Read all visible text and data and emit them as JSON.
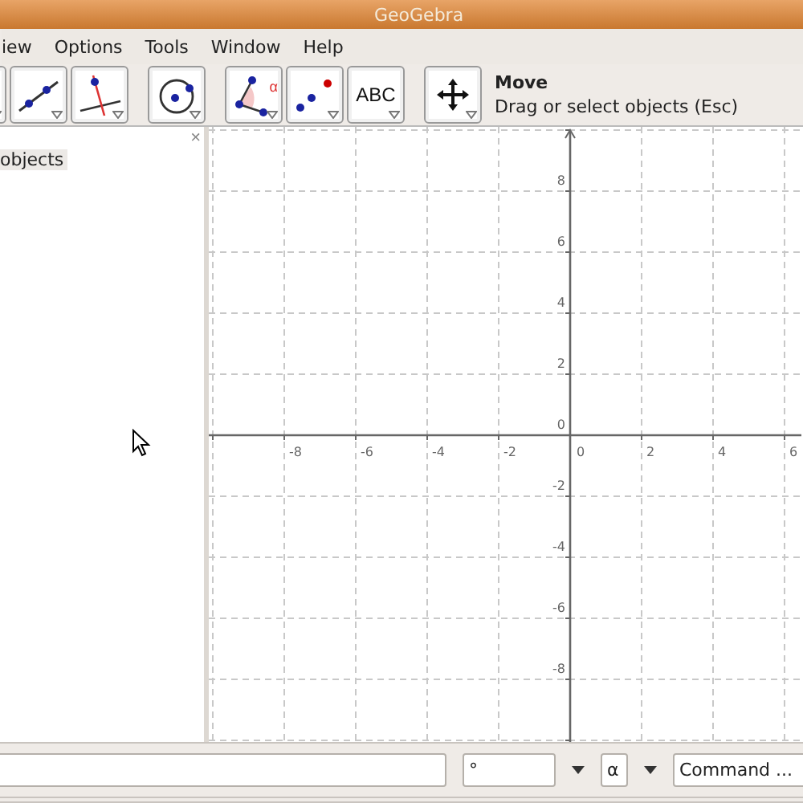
{
  "window": {
    "title": "GeoGebra"
  },
  "menu": [
    "iew",
    "Options",
    "Tools",
    "Window",
    "Help"
  ],
  "tool_groups": [
    [
      {
        "kind": "partial"
      },
      {
        "kind": "line"
      },
      {
        "kind": "perpendicular"
      }
    ],
    [
      {
        "kind": "circle"
      }
    ],
    [
      {
        "kind": "angle",
        "glyph": "α"
      },
      {
        "kind": "points"
      },
      {
        "kind": "text",
        "glyph": "ABC"
      }
    ],
    [
      {
        "kind": "move"
      }
    ]
  ],
  "tool_help": {
    "name": "Move",
    "description": "Drag or select objects (Esc)"
  },
  "algebra_view": {
    "heading": "objects",
    "close": "×"
  },
  "graphics": {
    "x_labels": [
      "-8",
      "-6",
      "-4",
      "-2",
      "0",
      "2",
      "4",
      "6"
    ],
    "y_labels": [
      "8",
      "6",
      "4",
      "2",
      "0",
      "-2",
      "-4",
      "-6",
      "-8"
    ]
  },
  "input_bar": {
    "symbol_dropdown": "°",
    "greek_dropdown": "α",
    "command_dropdown": "Command ..."
  }
}
